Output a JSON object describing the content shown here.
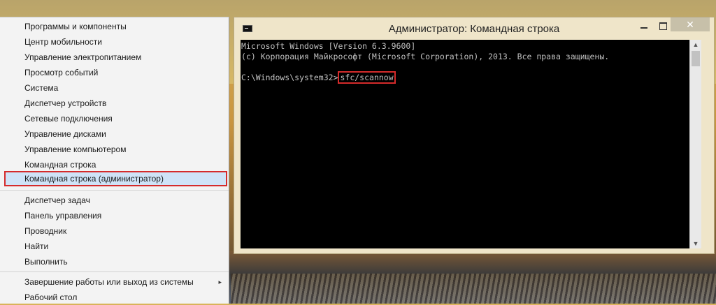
{
  "menu": {
    "items": [
      {
        "label": "Программы и компоненты"
      },
      {
        "label": "Центр мобильности"
      },
      {
        "label": "Управление электропитанием"
      },
      {
        "label": "Просмотр событий"
      },
      {
        "label": "Система"
      },
      {
        "label": "Диспетчер устройств"
      },
      {
        "label": "Сетевые подключения"
      },
      {
        "label": "Управление дисками"
      },
      {
        "label": "Управление компьютером"
      },
      {
        "label": "Командная строка"
      },
      {
        "label": "Командная строка (администратор)"
      },
      {
        "label": "Диспетчер задач"
      },
      {
        "label": "Панель управления"
      },
      {
        "label": "Проводник"
      },
      {
        "label": "Найти"
      },
      {
        "label": "Выполнить"
      },
      {
        "label": "Завершение работы или выход из системы"
      },
      {
        "label": "Рабочий стол"
      }
    ],
    "submenu_arrow": "▸"
  },
  "cmd": {
    "icon_text": "C:\\",
    "title": "Администратор: Командная строка",
    "close_glyph": "✕",
    "lines": [
      "Microsoft Windows [Version 6.3.9600]",
      "(c) Корпорация Майкрософт (Microsoft Corporation), 2013. Все права защищены."
    ],
    "prompt": "C:\\Windows\\system32>",
    "command": "sfc/scannow",
    "scroll_up": "▲",
    "scroll_down": "▼"
  }
}
